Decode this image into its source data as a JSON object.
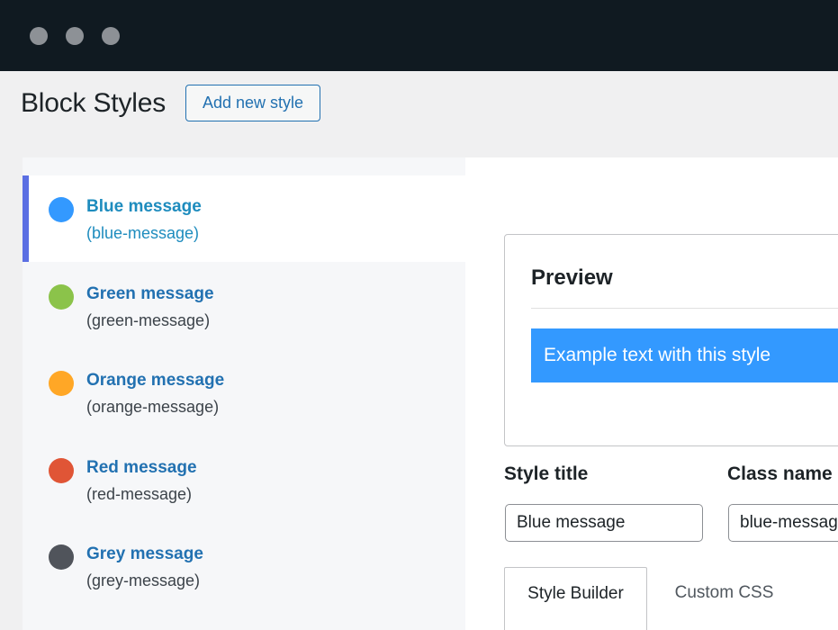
{
  "page": {
    "title": "Block Styles",
    "add_button_label": "Add new style"
  },
  "styles": [
    {
      "name": "Blue message",
      "class": "(blue-message)",
      "color": "#3399ff",
      "active": true
    },
    {
      "name": "Green message",
      "class": "(green-message)",
      "color": "#8bc34a",
      "active": false
    },
    {
      "name": "Orange message",
      "class": "(orange-message)",
      "color": "#ffa726",
      "active": false
    },
    {
      "name": "Red message",
      "class": "(red-message)",
      "color": "#e05536",
      "active": false
    },
    {
      "name": "Grey message",
      "class": "(grey-message)",
      "color": "#50545b",
      "active": false
    }
  ],
  "preview": {
    "title": "Preview",
    "sample_text": "Example text with this style",
    "sample_bg": "#3399ff"
  },
  "form": {
    "style_title_label": "Style title",
    "style_title_value": "Blue message",
    "class_name_label": "Class name",
    "class_name_value": "blue-message"
  },
  "tabs": [
    {
      "label": "Style Builder",
      "active": true
    },
    {
      "label": "Custom CSS",
      "active": false
    }
  ],
  "colors": {
    "accent": "#2271b1",
    "active_marker": "#5b6fe3"
  }
}
